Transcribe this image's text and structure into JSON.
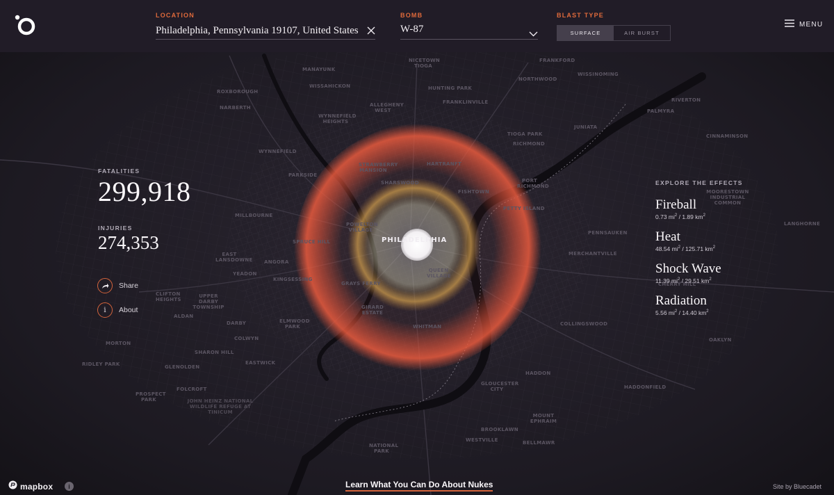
{
  "header": {
    "location_label": "LOCATION",
    "location_value": "Philadelphia, Pennsylvania 19107, United States",
    "bomb_label": "BOMB",
    "bomb_value": "W-87",
    "blast_type_label": "BLAST TYPE",
    "blast_options": [
      "SURFACE",
      "AIR BURST"
    ],
    "blast_selected": "SURFACE",
    "menu_label": "MENU"
  },
  "stats": {
    "fatalities_label": "FATALITIES",
    "fatalities_value": "299,918",
    "injuries_label": "INJURIES",
    "injuries_value": "274,353"
  },
  "actions": {
    "share_label": "Share",
    "about_label": "About",
    "about_glyph": "i"
  },
  "effects": {
    "title": "EXPLORE THE EFFECTS",
    "items": [
      {
        "name": "Fireball",
        "area_mi": "0.73 mi",
        "area_km": "1.89 km"
      },
      {
        "name": "Heat",
        "area_mi": "48.54 mi",
        "area_km": "125.71 km"
      },
      {
        "name": "Shock Wave",
        "area_mi": "11.39 mi",
        "area_km": "29.51 km"
      },
      {
        "name": "Radiation",
        "area_mi": "5.56 mi",
        "area_km": "14.40 km"
      }
    ]
  },
  "map": {
    "center_label": "PHILADELPHIA",
    "neighborhoods": [
      "MANAYUNK",
      "WISSAHICKON",
      "NICETOWN TIOGA",
      "FRANKFORD",
      "WISSINOMING",
      "ROXBOROUGH",
      "NORTHWOOD",
      "HUNTING PARK",
      "NARBERTH",
      "ALLEGHENY WEST",
      "FRANKLINVILLE",
      "PALMYRA",
      "RIVERTON",
      "WYNNEFIELD HEIGHTS",
      "JUNIATA",
      "TIOGA PARK",
      "RICHMOND",
      "CINNAMINSON",
      "WYNNEFIELD",
      "STRAWBERRY MANSION",
      "HARTRANFT",
      "PARKSIDE",
      "SHARSWOOD",
      "FISHTOWN",
      "PORT RICHMOND",
      "MOORESTOWN INDUSTRIAL COMMON",
      "PETTY ISLAND",
      "MILLBOURNE",
      "POWELTON VILLAGE",
      "PENNSAUKEN",
      "SPRUCE HILL",
      "EAST LANSDOWNE",
      "MERCHANTVILLE",
      "ANGORA",
      "QUEEN VILLAGE",
      "YEADON",
      "KINGSESSING",
      "GRAYS FERRY",
      "CLIFTON HEIGHTS",
      "UPPER DARBY TOWNSHIP",
      "GIRARD ESTATE",
      "ALDAN",
      "DARBY",
      "ELMWOOD PARK",
      "WHITMAN",
      "COLLINGSWOOD",
      "COLWYN",
      "MORTON",
      "SHARON HILL",
      "FOLCROFT",
      "GLENOLDEN",
      "EASTWICK",
      "GLOUCESTER CITY",
      "HADDON",
      "HADDONFIELD",
      "PROSPECT PARK",
      "NATIONAL PARK",
      "MOUNT EPHRAIM",
      "BROOKLAWN",
      "WESTVILLE",
      "BELLMAWR",
      "RIDLEY PARK",
      "JOHN HEINZ NATIONAL WILDLIFE REFUGE AT TINICUM",
      "CHERRY HILL",
      "LANGHORNE",
      "OAKLYN"
    ]
  },
  "footer": {
    "mapbox_label": "mapbox",
    "info_glyph": "i",
    "learn_link": "Learn What You Can Do About Nukes",
    "credit": "Site by Bluecadet"
  },
  "colors": {
    "accent": "#d5643c",
    "header_bg": "#211c27",
    "map_bg": "#1a1720",
    "heat_ring": "#e2533a",
    "shock_ring": "#b08a4a",
    "fireball": "#f5f2f5"
  }
}
